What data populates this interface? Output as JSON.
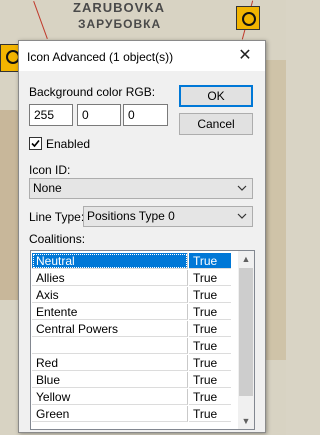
{
  "map": {
    "place_name_latin": "ZARUBOVKA",
    "place_name_cyrillic": "ЗАРУБОВКА"
  },
  "dialog": {
    "title": "Icon Advanced (1 object(s))",
    "close_glyph": "✕",
    "background_color_label": "Background color RGB:",
    "rgb": {
      "r": "255",
      "g": "0",
      "b": "0"
    },
    "ok_label": "OK",
    "cancel_label": "Cancel",
    "enabled_label": "Enabled",
    "enabled_checked": true,
    "icon_id_label": "Icon ID:",
    "icon_id_value": "None",
    "line_type_label": "Line Type:",
    "line_type_value": "Positions Type 0",
    "coalitions_label": "Coalitions:",
    "coalitions": [
      {
        "name": "Neutral",
        "value": "True",
        "selected": true
      },
      {
        "name": "Allies",
        "value": "True"
      },
      {
        "name": "Axis",
        "value": "True"
      },
      {
        "name": "Entente",
        "value": "True"
      },
      {
        "name": "Central Powers",
        "value": "True"
      },
      {
        "name": "",
        "value": "True"
      },
      {
        "name": "Red",
        "value": "True"
      },
      {
        "name": "Blue",
        "value": "True"
      },
      {
        "name": "Yellow",
        "value": "True"
      },
      {
        "name": "Green",
        "value": "True"
      }
    ]
  },
  "colors": {
    "selection": "#0078d7",
    "marker": "#f2b400"
  }
}
